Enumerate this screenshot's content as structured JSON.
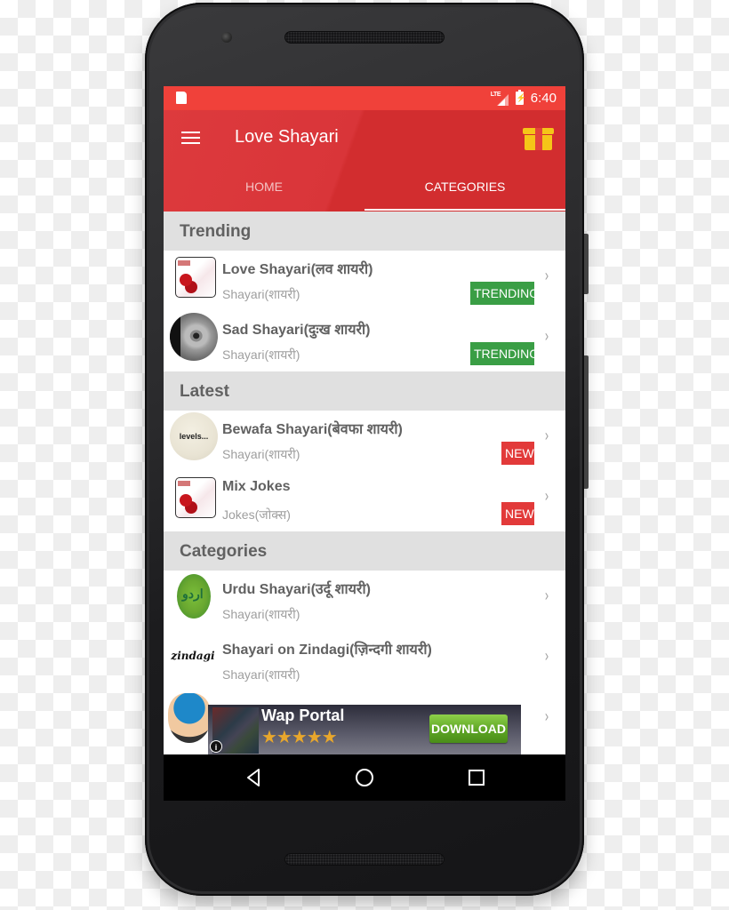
{
  "status_bar": {
    "sd_icon": "sd-card-icon",
    "network_label": "LTE",
    "signal_icon": "signal-icon",
    "battery_icon": "battery-charging-icon",
    "time": "6:40"
  },
  "app_bar": {
    "menu_icon": "hamburger-menu-icon",
    "title": "Love Shayari",
    "gift_icon": "gift-icon",
    "accent_color": "#d32f2f",
    "tabs": [
      {
        "label": "HOME",
        "active": false
      },
      {
        "label": "CATEGORIES",
        "active": true
      }
    ]
  },
  "sections": [
    {
      "header": "Trending",
      "items": [
        {
          "title": "Love Shayari(लव शायरी)",
          "subtitle": "Shayari(शायरी)",
          "badge": "TRENDING"
        },
        {
          "title": "Sad Shayari(दुःख शायरी)",
          "subtitle": "Shayari(शायरी)",
          "badge": "TRENDING"
        }
      ]
    },
    {
      "header": "Latest",
      "items": [
        {
          "title": "Bewafa Shayari(बेवफा शायरी)",
          "subtitle": "Shayari(शायरी)",
          "badge": "NEW",
          "thumb_text": "levels..."
        },
        {
          "title": "Mix Jokes",
          "subtitle": "Jokes(जोक्स)",
          "badge": "NEW"
        }
      ]
    },
    {
      "header": "Categories",
      "items": [
        {
          "title": "Urdu Shayari(उर्दू शायरी)",
          "subtitle": "Shayari(शायरी)"
        },
        {
          "title": "Shayari on Zindagi(ज़िन्दगी शायरी)",
          "subtitle": "Shayari(शायरी)",
          "thumb_text": "zindagi"
        }
      ]
    }
  ],
  "badge_colors": {
    "TRENDING": "#3a9e45",
    "NEW": "#e23a3a"
  },
  "ad": {
    "title": "Wap Portal",
    "stars": "★★★★★",
    "rating": 5,
    "button_label": "DOWNLOAD",
    "info_label": "i"
  },
  "chevron": "›",
  "nav_bar": {
    "back_icon": "back-triangle-icon",
    "home_icon": "home-circle-icon",
    "recents_icon": "recents-square-icon"
  }
}
